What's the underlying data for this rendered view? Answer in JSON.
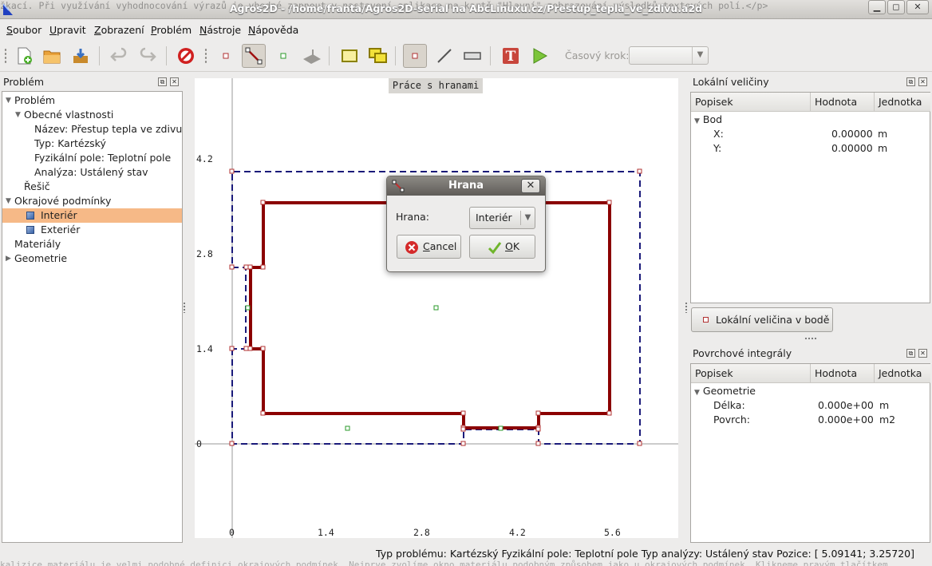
{
  "window": {
    "title": "Agros2D - /home/franta/Agros2D-serial na AbcLinuxu.cz/Prestup_tepla_ve_zdivu.a2d",
    "background_text_top": "žkací. Při využívání vyhodnocování výrazů je vhodné zapnout v nastavení aplikace na kartě \"Hlavní\" zobrazování výsledků textových polí.</p>",
    "background_text_bottom": "kalizice materiálu je velmi podobné definici okrajových podmínek. Nejprve zvolíme okno materiálu podobným způsobem jako u okrajových podmínek. Klikneme pravým tlačítkem"
  },
  "menu": {
    "items": [
      {
        "label": "Soubor",
        "accel": "S",
        "rest": "oubor"
      },
      {
        "label": "Upravit",
        "accel": "U",
        "rest": "pravit"
      },
      {
        "label": "Zobrazení",
        "accel": "Z",
        "rest": "obrazení"
      },
      {
        "label": "Problém",
        "accel": "P",
        "rest": "roblém"
      },
      {
        "label": "Nástroje",
        "accel": "N",
        "rest": "ástroje"
      },
      {
        "label": "Nápověda",
        "accel": "N",
        "rest": "ápověda"
      }
    ]
  },
  "toolbar": {
    "time_step_label": "Časový krok:",
    "time_step_value": ""
  },
  "problem_panel": {
    "title": "Problém",
    "tree": [
      {
        "label": "Problém",
        "level": 0,
        "expander": "open"
      },
      {
        "label": "Obecné vlastnosti",
        "level": 1,
        "expander": "open"
      },
      {
        "label": "Název: Přestup tepla ve zdivu",
        "level": 2
      },
      {
        "label": "Typ: Kartézský",
        "level": 2
      },
      {
        "label": "Fyzikální pole: Teplotní pole",
        "level": 2
      },
      {
        "label": "Analýza: Ustálený stav",
        "level": 2
      },
      {
        "label": "Řešič",
        "level": 1
      },
      {
        "label": "Okrajové podmínky",
        "level": 0,
        "expander": "open"
      },
      {
        "label": "Interiér",
        "level": 1,
        "icon": "cube",
        "selected": true
      },
      {
        "label": "Exteriér",
        "level": 1,
        "icon": "cube"
      },
      {
        "label": "Materiály",
        "level": 0
      },
      {
        "label": "Geometrie",
        "level": 0,
        "expander": "closed"
      }
    ]
  },
  "canvas": {
    "header": "Práce s hranami",
    "y_ticks": [
      "4.2",
      "2.8",
      "1.4",
      "0"
    ],
    "x_ticks": [
      "0",
      "1.4",
      "2.8",
      "4.2",
      "5.6"
    ]
  },
  "local_values_panel": {
    "title": "Lokální veličiny",
    "columns": [
      "Popisek",
      "Hodnota",
      "Jednotka"
    ],
    "group": "Bod",
    "rows": [
      {
        "name": "X:",
        "value": "0.00000",
        "unit": "m"
      },
      {
        "name": "Y:",
        "value": "0.00000",
        "unit": "m"
      }
    ],
    "button_label": "Lokální veličina v bodě"
  },
  "surface_integrals_panel": {
    "title": "Povrchové integrály",
    "columns": [
      "Popisek",
      "Hodnota",
      "Jednotka"
    ],
    "group": "Geometrie",
    "rows": [
      {
        "name": "Délka:",
        "value": "0.000e+00",
        "unit": "m"
      },
      {
        "name": "Povrch:",
        "value": "0.000e+00",
        "unit": "m2"
      }
    ]
  },
  "status_bar": {
    "problem_type": "Typ problému: Kartézský",
    "field": "Fyzikální pole: Teplotní pole",
    "analysis": "Typ analýzy: Ustálený stav",
    "position": "Pozice: [ 5.09141;  3.25720]"
  },
  "dialog": {
    "title": "Hrana",
    "field_label": "Hrana:",
    "selected_value": "Interiér",
    "cancel_label": "Cancel",
    "cancel_accel": "C",
    "cancel_rest": "ancel",
    "ok_label": "OK",
    "ok_accel": "O",
    "ok_rest": "K"
  },
  "colors": {
    "wall_edge": "#8b0000",
    "boundary_dashed": "#1a1a7a",
    "selection": "#f6b987"
  }
}
